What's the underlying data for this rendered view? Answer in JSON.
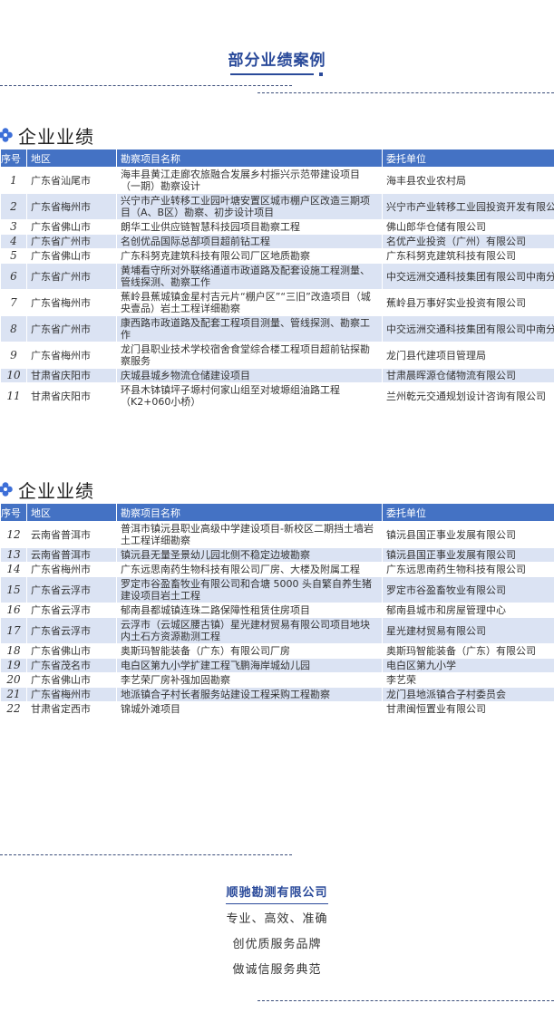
{
  "header": {
    "title": "部分业绩案例"
  },
  "columns": {
    "no": "序号",
    "region": "地区",
    "project": "勘察项目名称",
    "client": "委托单位"
  },
  "section1": {
    "title": "企业业绩",
    "rows": [
      {
        "no": "1",
        "region": "广东省汕尾市",
        "project": "海丰县黄江走廊农旅融合发展乡村振兴示范带建设项目（一期）勘察设计",
        "client": "海丰县农业农村局"
      },
      {
        "no": "2",
        "region": "广东省梅州市",
        "project": "兴宁市产业转移工业园叶塘安置区城市棚户区改造三期项目（A、B区）勘察、初步设计项目",
        "client": "兴宁市产业转移工业园投资开发有限公司"
      },
      {
        "no": "3",
        "region": "广东省佛山市",
        "project": "朗华工业供应链智慧科技园项目勘察工程",
        "client": "佛山郎华仓储有限公司"
      },
      {
        "no": "4",
        "region": "广东省广州市",
        "project": "名创优品国际总部项目超前钻工程",
        "client": "名优产业投资（广州）有限公司"
      },
      {
        "no": "5",
        "region": "广东省佛山市",
        "project": "广东科努克建筑科技有限公司厂区地质勘察",
        "client": "广东科努克建筑科技有限公司"
      },
      {
        "no": "6",
        "region": "广东省广州市",
        "project": "黄埔看守所对外联络通道市政道路及配套设施工程测量、管线探测、勘察工作",
        "client": "中交远洲交通科技集团有限公司中南分公司"
      },
      {
        "no": "7",
        "region": "广东省梅州市",
        "project": "蕉岭县蕉城镇金星村吉元片“棚户区”“三旧”改造项目（城央壹品）岩土工程详细勘察",
        "client": "蕉岭县万事好实业投资有限公司"
      },
      {
        "no": "8",
        "region": "广东省广州市",
        "project": "康西路市政道路及配套工程项目测量、管线探测、勘察工作",
        "client": "中交远洲交通科技集团有限公司中南分公司"
      },
      {
        "no": "9",
        "region": "广东省梅州市",
        "project": "龙门县职业技术学校宿舍食堂综合楼工程项目超前钻探勘察服务",
        "client": "龙门县代建项目管理局"
      },
      {
        "no": "10",
        "region": "甘肃省庆阳市",
        "project": "庆城县城乡物流仓储建设项目",
        "client": "甘肃晨晖源仓储物流有限公司"
      },
      {
        "no": "11",
        "region": "甘肃省庆阳市",
        "project": "环县木钵镇坪子塬村何家山组至对坡塬组油路工程（K2+060小桥）",
        "client": "兰州乾元交通规划设计咨询有限公司"
      }
    ]
  },
  "section2": {
    "title": "企业业绩",
    "rows": [
      {
        "no": "12",
        "region": "云南省普洱市",
        "project": "普洱市镇沅县职业高级中学建设项目-新校区二期挡土墙岩土工程详细勘察",
        "client": "镇沅县国正事业发展有限公司"
      },
      {
        "no": "13",
        "region": "云南省普洱市",
        "project": "镇沅县无量圣景幼儿园北侧不稳定边坡勘察",
        "client": "镇沅县国正事业发展有限公司"
      },
      {
        "no": "14",
        "region": "广东省梅州市",
        "project": "广东远思南药生物科技有限公司厂房、大楼及附属工程",
        "client": "广东远思南药生物科技有限公司"
      },
      {
        "no": "15",
        "region": "广东省云浮市",
        "project": "罗定市谷盈畜牧业有限公司和合塘 5000 头自繁自养生猪建设项目岩土工程",
        "client": "罗定市谷盈畜牧业有限公司"
      },
      {
        "no": "16",
        "region": "广东省云浮市",
        "project": "郁南县都城镇连珠二路保障性租赁住房项目",
        "client": "郁南县城市和房屋管理中心"
      },
      {
        "no": "17",
        "region": "广东省云浮市",
        "project": "云浮市（云城区腰古镇）星光建材贸易有限公司项目地块内土石方资源勘测工程",
        "client": "星光建材贸易有限公司"
      },
      {
        "no": "18",
        "region": "广东省佛山市",
        "project": "奥斯玛智能装备（广东）有限公司厂房",
        "client": "奥斯玛智能装备（广东）有限公司"
      },
      {
        "no": "19",
        "region": "广东省茂名市",
        "project": "电白区第九小学扩建工程飞鹏海岸城幼儿园",
        "client": "电白区第九小学"
      },
      {
        "no": "20",
        "region": "广东省佛山市",
        "project": "李艺荣厂房补强加固勘察",
        "client": "李艺荣"
      },
      {
        "no": "21",
        "region": "广东省梅州市",
        "project": "地派镇合子村长者服务站建设工程采购工程勘察",
        "client": "龙门县地派镇合子村委员会"
      },
      {
        "no": "22",
        "region": "甘肃省定西市",
        "project": "锦城外滩项目",
        "client": "甘肃闽恒置业有限公司"
      }
    ]
  },
  "footer": {
    "company": "顺驰勘测有限公司",
    "slogans": [
      "专业、高效、准确",
      "创优质服务品牌",
      "做诚信服务典范"
    ]
  },
  "colors": {
    "accent": "#2a4a9a",
    "header_fill": "#4472c4",
    "stripe": "#dbe3f3"
  },
  "icons": {
    "section_marker": "flower-icon"
  }
}
